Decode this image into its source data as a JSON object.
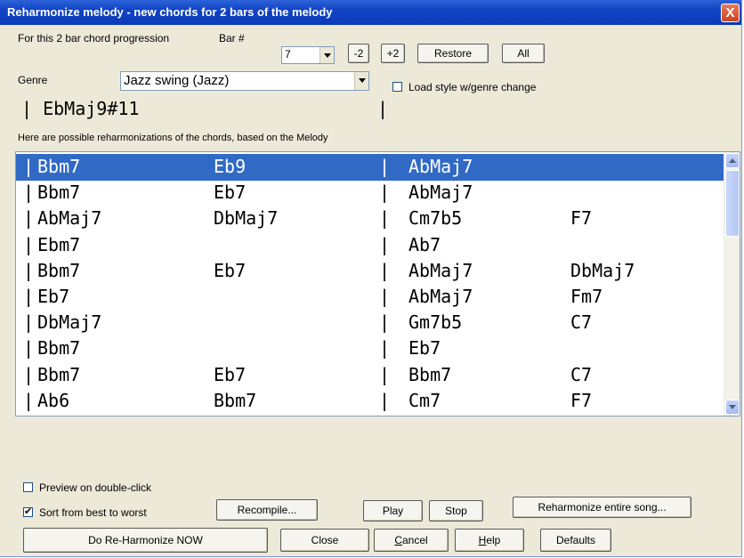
{
  "window": {
    "title": "Reharmonize melody - new chords for 2 bars of the melody",
    "close_glyph": "X"
  },
  "top": {
    "progression_label": "For this 2 bar chord progression",
    "bar_label": "Bar #",
    "bar_value": "7",
    "minus2": "-2",
    "plus2": "+2",
    "restore": "Restore",
    "all": "All"
  },
  "genre": {
    "label": "Genre",
    "value": "Jazz swing (Jazz)",
    "load_style_label": "Load style w/genre change",
    "load_style_checked": false
  },
  "current_chord": "| EbMaj9#11",
  "current_bar_sep": "|",
  "list_caption": "Here are possible reharmonizations of the chords, based on the Melody",
  "rows": [
    {
      "c1": "Bbm7",
      "c2": "Eb9",
      "c3": "AbMaj7",
      "c4": "",
      "selected": true
    },
    {
      "c1": "Bbm7",
      "c2": "Eb7",
      "c3": "AbMaj7",
      "c4": ""
    },
    {
      "c1": "AbMaj7",
      "c2": "DbMaj7",
      "c3": "Cm7b5",
      "c4": "F7"
    },
    {
      "c1": "Ebm7",
      "c2": "",
      "c3": "Ab7",
      "c4": ""
    },
    {
      "c1": "Bbm7",
      "c2": "Eb7",
      "c3": "AbMaj7",
      "c4": "DbMaj7"
    },
    {
      "c1": "Eb7",
      "c2": "",
      "c3": "AbMaj7",
      "c4": "Fm7"
    },
    {
      "c1": "DbMaj7",
      "c2": "",
      "c3": "Gm7b5",
      "c4": "C7"
    },
    {
      "c1": "Bbm7",
      "c2": "",
      "c3": "Eb7",
      "c4": ""
    },
    {
      "c1": "Bbm7",
      "c2": "Eb7",
      "c3": "Bbm7",
      "c4": "C7"
    },
    {
      "c1": "Ab6",
      "c2": "Bbm7",
      "c3": "Cm7",
      "c4": "F7"
    }
  ],
  "bar_sep": "|",
  "options": {
    "preview_label": "Preview on double-click",
    "preview_checked": false,
    "sort_label": "Sort from best to worst",
    "sort_checked": true
  },
  "buttons": {
    "recompile": "Recompile...",
    "play": "Play",
    "stop": "Stop",
    "reharm_song": "Reharmonize entire song...",
    "do_reharm": "Do Re-Harmonize NOW",
    "close": "Close",
    "cancel_u": "C",
    "cancel_rest": "ancel",
    "help_u": "H",
    "help_rest": "elp",
    "defaults": "Defaults"
  }
}
